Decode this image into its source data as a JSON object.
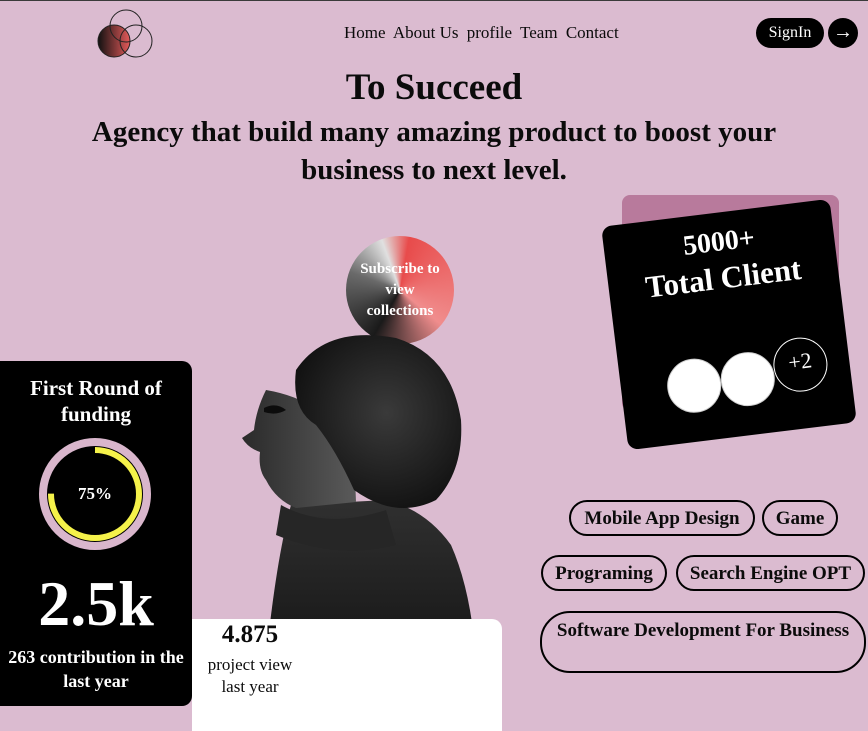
{
  "nav": {
    "items": [
      "Home",
      "About Us",
      "profile",
      "Team",
      "Contact"
    ],
    "signin_label": "SignIn",
    "arrow_glyph": "→"
  },
  "hero": {
    "title": "To Succeed",
    "subtitle": "Agency that build many amazing product to boost your business to next level."
  },
  "subscribe": {
    "label": "Subscribe to view collections"
  },
  "clients": {
    "count": "5000+",
    "label": "Total Client",
    "more": "+2"
  },
  "funding": {
    "title": "First Round of funding",
    "percent_label": "75%",
    "progress": 0.75,
    "big_number": "2.5k",
    "caption": "263 contribution in the last year"
  },
  "views": {
    "number": "4.875",
    "label": "project view last year"
  },
  "services": [
    "Mobile App Design",
    "Game",
    "Programing",
    "Search Engine OPT",
    "Software Development For Business"
  ],
  "colors": {
    "background": "#dbbbd0",
    "card": "#000000",
    "accent": "#b87a9c",
    "ring_progress": "#f5f24a",
    "ring_track": "#d9b6cc"
  },
  "icons": {
    "logo": "overlapping-circles-logo",
    "arrow": "arrow-right-icon"
  }
}
